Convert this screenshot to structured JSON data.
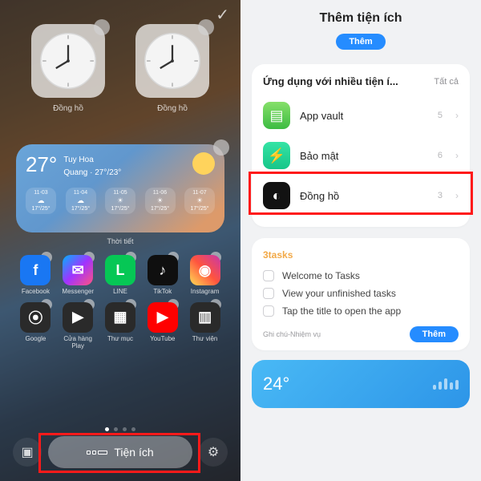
{
  "left": {
    "clocks": [
      {
        "label": "Đồng hồ"
      },
      {
        "label": "Đồng hồ"
      }
    ],
    "weather": {
      "temp": "27°",
      "loc_line1": "Tuy Hoa",
      "loc_line2": "Quang · 27°/23°",
      "days": [
        {
          "d": "11-03",
          "i": "☁",
          "r": "17°/25°"
        },
        {
          "d": "11-04",
          "i": "☁",
          "r": "17°/25°"
        },
        {
          "d": "11-05",
          "i": "☀",
          "r": "17°/25°"
        },
        {
          "d": "11-06",
          "i": "☀",
          "r": "17°/25°"
        },
        {
          "d": "11-07",
          "i": "☀",
          "r": "17°/25°"
        }
      ],
      "label": "Thời tiết"
    },
    "apps": [
      {
        "name": "Facebook",
        "bg": "#1977f3",
        "glyph": "f"
      },
      {
        "name": "Messenger",
        "bg": "linear-gradient(135deg,#00b2ff,#a033ff,#ff5280)",
        "glyph": "✉"
      },
      {
        "name": "LINE",
        "bg": "#06c755",
        "glyph": "L"
      },
      {
        "name": "TikTok",
        "bg": "#0f0f0f",
        "glyph": "♪"
      },
      {
        "name": "Instagram",
        "bg": "linear-gradient(45deg,#fd5,#ff543e,#c837ab)",
        "glyph": "◉"
      },
      {
        "name": "Google",
        "bg": "#2a2a2a",
        "glyph": "⦿"
      },
      {
        "name": "Cửa hàng Play",
        "bg": "#2a2a2a",
        "glyph": "▶"
      },
      {
        "name": "Thư mục",
        "bg": "#2a2a2a",
        "glyph": "▦"
      },
      {
        "name": "YouTube",
        "bg": "#ff0000",
        "glyph": "▶"
      },
      {
        "name": "Thư viện",
        "bg": "#2a2a2a",
        "glyph": "▥"
      }
    ],
    "bottom": {
      "widget_label": "Tiện ích"
    }
  },
  "right": {
    "title": "Thêm tiện ích",
    "add_btn": "Thêm",
    "apps": {
      "heading": "Ứng dụng với nhiều tiện í...",
      "all": "Tất cả",
      "rows": [
        {
          "name": "App vault",
          "count": "5",
          "bg": "linear-gradient(#86e06a,#3dbb42)",
          "glyph": "▤"
        },
        {
          "name": "Bảo mật",
          "count": "6",
          "bg": "linear-gradient(#35e3a4,#17c689)",
          "glyph": "⚡"
        },
        {
          "name": "Đồng hồ",
          "count": "3",
          "bg": "#121212",
          "glyph": "◐"
        }
      ]
    },
    "tasks": {
      "title": "3tasks",
      "items": [
        "Welcome to Tasks",
        "View your unfinished tasks",
        "Tap the title to open the app"
      ],
      "footer": "Ghi chú-Nhiệm vụ",
      "add": "Thêm"
    },
    "weather": {
      "temp": "24°"
    }
  }
}
